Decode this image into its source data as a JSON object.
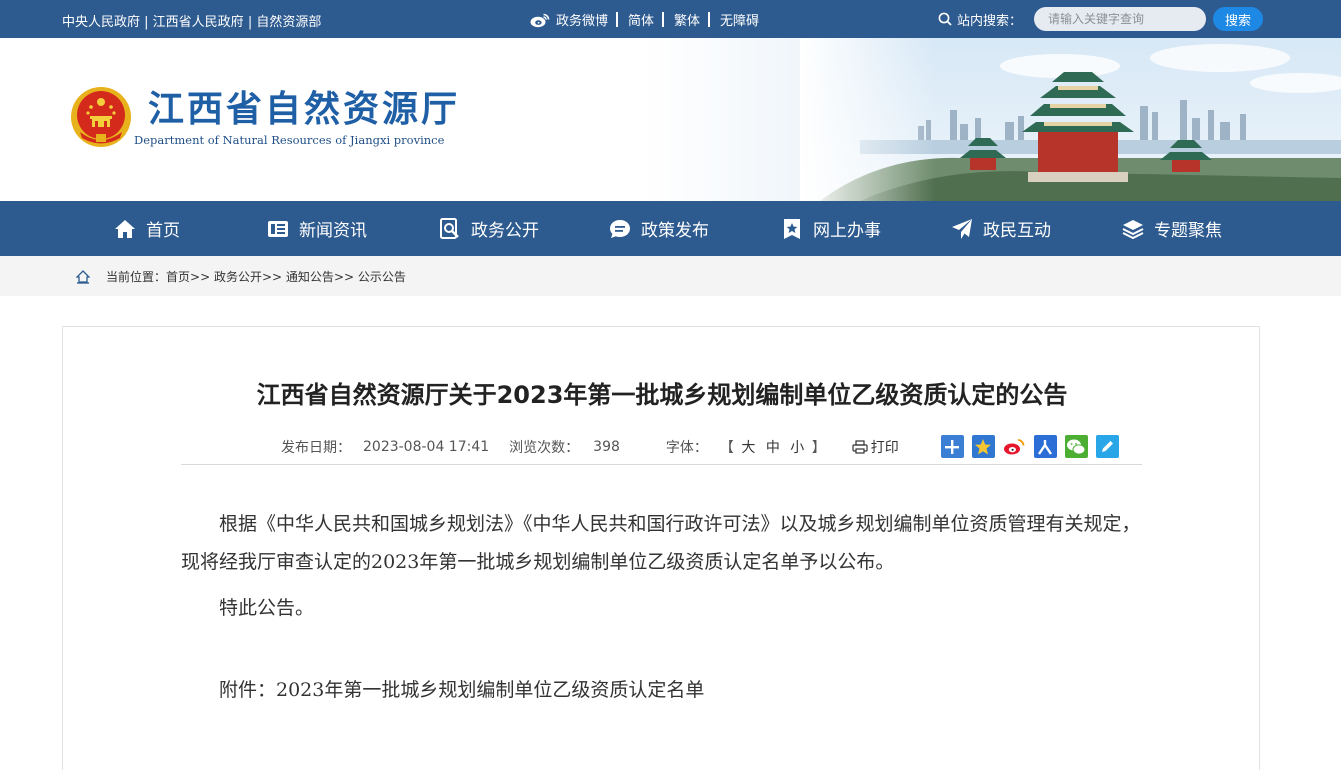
{
  "topbar": {
    "gov_links": [
      "中央人民政府",
      "江西省人民政府",
      "自然资源部"
    ],
    "link_sep": " | ",
    "weibo": "政务微博",
    "simplified": "简体",
    "traditional": "繁体",
    "accessible": "无障碍",
    "search_label": "站内搜索：",
    "search_placeholder": "请输入关键字查询",
    "search_button": "搜索"
  },
  "header": {
    "title": "江西省自然资源厅",
    "subtitle": "Department of Natural Resources of Jiangxi province"
  },
  "nav": {
    "items": [
      {
        "label": "首页",
        "icon": "home-icon"
      },
      {
        "label": "新闻资讯",
        "icon": "news-icon"
      },
      {
        "label": "政务公开",
        "icon": "search-doc-icon"
      },
      {
        "label": "政策发布",
        "icon": "chat-icon"
      },
      {
        "label": "网上办事",
        "icon": "bookmark-star-icon"
      },
      {
        "label": "政民互动",
        "icon": "paper-plane-icon"
      },
      {
        "label": "专题聚焦",
        "icon": "layers-icon"
      }
    ]
  },
  "breadcrumb": {
    "prefix": "当前位置：",
    "items": [
      "首页",
      "政务公开",
      "通知公告",
      "公示公告"
    ],
    "sep": ">>"
  },
  "article": {
    "title": "江西省自然资源厅关于2023年第一批城乡规划编制单位乙级资质认定的公告",
    "date_label": "发布日期：",
    "date": "2023-08-04 17:41",
    "views_label": "浏览次数：",
    "views": "398",
    "font_label": "字体：",
    "font_open": "【",
    "font_large": "大",
    "font_medium": "中",
    "font_small": "小",
    "font_close": "】",
    "print": "打印",
    "share_icons": [
      "plus-share-icon",
      "star-share-icon",
      "weibo-share-icon",
      "people-share-icon",
      "wechat-share-icon",
      "edit-share-icon"
    ],
    "paragraph1": "根据《中华人民共和国城乡规划法》《中华人民共和国行政许可法》以及城乡规划编制单位资质管理有关规定，现将经我厅审查认定的2023年第一批城乡规划编制单位乙级资质认定名单予以公布。",
    "paragraph2": "特此公告。",
    "attachment": "附件：2023年第一批城乡规划编制单位乙级资质认定名单"
  },
  "colors": {
    "primary": "#2d5a8f",
    "title_blue": "#1f5fa6",
    "search_button": "#1e88e5"
  }
}
